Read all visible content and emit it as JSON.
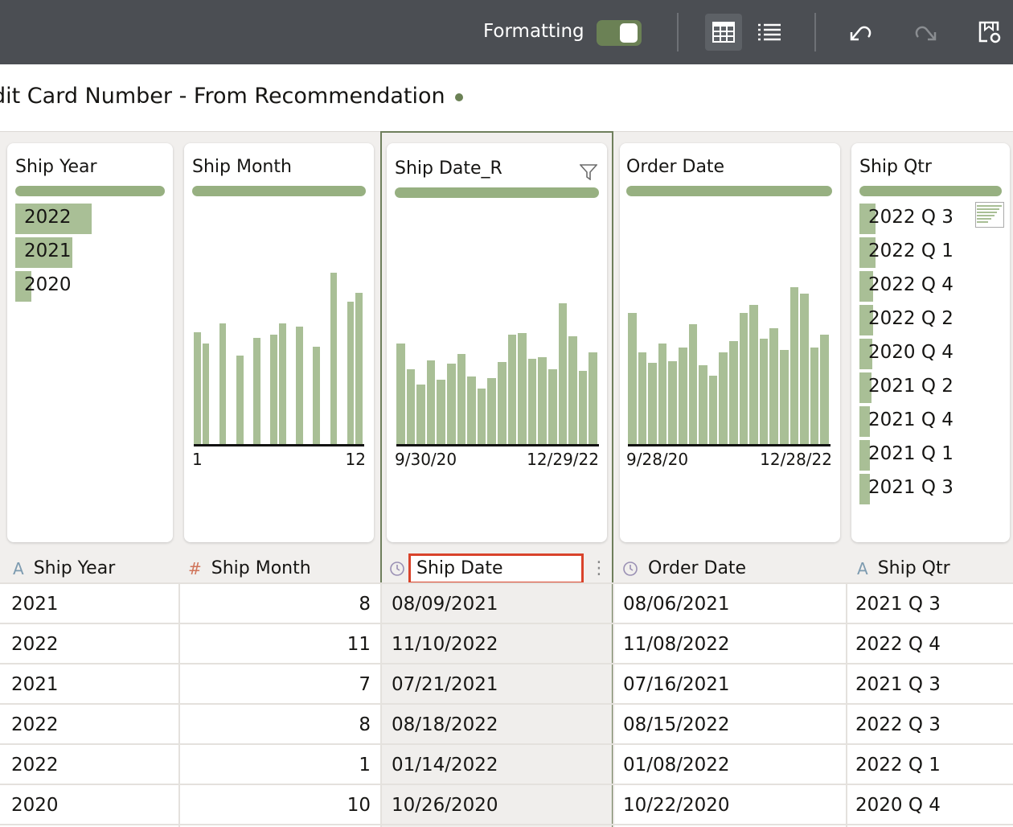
{
  "toolbar": {
    "formatting_label": "Formatting",
    "formatting_on": true,
    "icons": [
      "table-view-icon",
      "list-view-icon",
      "undo-icon",
      "redo-icon",
      "save-refresh-icon"
    ]
  },
  "title": "dit Card Number - From Recommendation",
  "colors": {
    "accent": "#6b8155",
    "bar": "#a9bf96",
    "selected_border": "#6f7f5c",
    "header_highlight": "#d9432b"
  },
  "cards": [
    {
      "title": "Ship Year",
      "type": "list",
      "items": [
        {
          "label": "2022",
          "share": 0.51
        },
        {
          "label": "2021",
          "share": 0.38
        },
        {
          "label": "2020",
          "share": 0.11
        }
      ]
    },
    {
      "title": "Ship Month",
      "type": "histogram",
      "min_label": "1",
      "max_label": "12",
      "bars": [
        140,
        126,
        0,
        151,
        0,
        111,
        0,
        133,
        0,
        137,
        151,
        0,
        147,
        0,
        122,
        0,
        214,
        0,
        178,
        189
      ]
    },
    {
      "title": "Ship Date_R",
      "type": "histogram",
      "min_label": "9/30/20",
      "max_label": "12/29/22",
      "bars": [
        126,
        94,
        75,
        105,
        81,
        101,
        113,
        85,
        70,
        83,
        103,
        137,
        139,
        107,
        109,
        94,
        176,
        135,
        92,
        115
      ]
    },
    {
      "title": "Order Date",
      "type": "histogram",
      "min_label": "9/28/20",
      "max_label": "12/28/22",
      "bars": [
        164,
        115,
        102,
        126,
        104,
        121,
        150,
        99,
        86,
        115,
        129,
        164,
        174,
        132,
        145,
        118,
        196,
        188,
        121,
        137
      ]
    },
    {
      "title": "Ship Qtr",
      "type": "list",
      "items": [
        {
          "label": "2022 Q 3",
          "share": 0.11
        },
        {
          "label": "2022 Q 1",
          "share": 0.105
        },
        {
          "label": "2022 Q 4",
          "share": 0.09
        },
        {
          "label": "2022 Q 2",
          "share": 0.09
        },
        {
          "label": "2020 Q 4",
          "share": 0.085
        },
        {
          "label": "2021 Q 2",
          "share": 0.078
        },
        {
          "label": "2021 Q 4",
          "share": 0.072
        },
        {
          "label": "2021 Q 1",
          "share": 0.072
        },
        {
          "label": "2021 Q 3",
          "share": 0.072
        }
      ]
    }
  ],
  "columns": [
    {
      "name": "Ship Year",
      "type_icon": "A",
      "align": "left"
    },
    {
      "name": "Ship Month",
      "type_icon": "#",
      "align": "right"
    },
    {
      "name": "Ship Date",
      "type_icon": "clock",
      "align": "left",
      "editing": true
    },
    {
      "name": "Order Date",
      "type_icon": "clock",
      "align": "left"
    },
    {
      "name": "Ship Qtr",
      "type_icon": "A",
      "align": "left"
    }
  ],
  "rows": [
    [
      "2021",
      "8",
      "08/09/2021",
      "08/06/2021",
      "2021 Q 3"
    ],
    [
      "2022",
      "11",
      "11/10/2022",
      "11/08/2022",
      "2022 Q 4"
    ],
    [
      "2021",
      "7",
      "07/21/2021",
      "07/16/2021",
      "2021 Q 3"
    ],
    [
      "2022",
      "8",
      "08/18/2022",
      "08/15/2022",
      "2022 Q 3"
    ],
    [
      "2022",
      "1",
      "01/14/2022",
      "01/08/2022",
      "2022 Q 1"
    ],
    [
      "2020",
      "10",
      "10/26/2020",
      "10/22/2020",
      "2020 Q 4"
    ]
  ]
}
